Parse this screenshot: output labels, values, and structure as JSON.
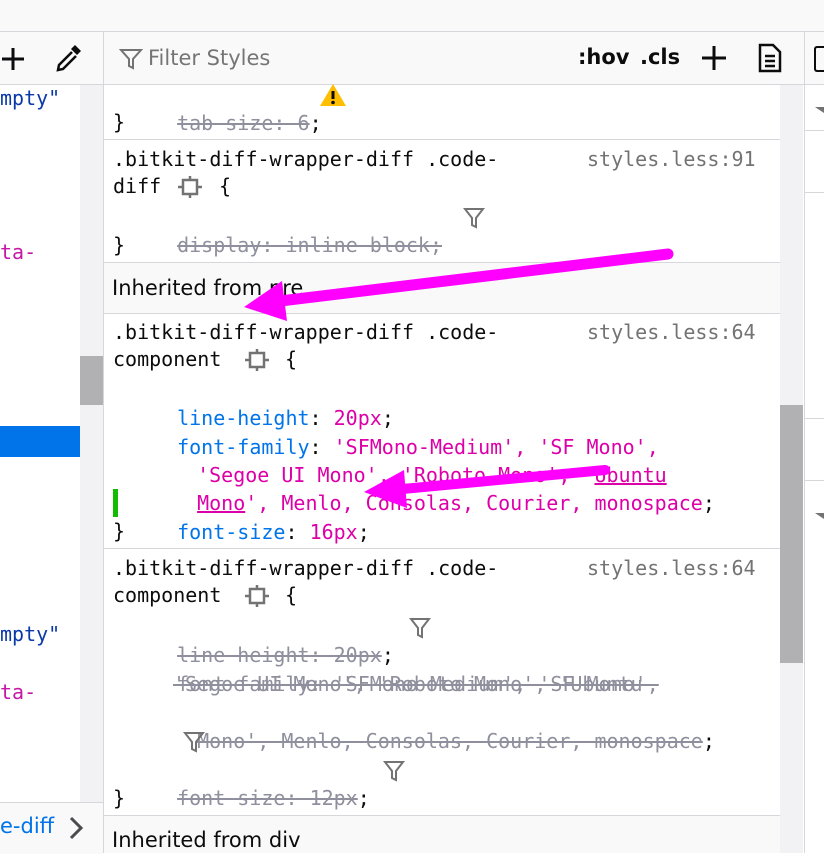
{
  "filter": {
    "placeholder": "Filter Styles"
  },
  "toolbar": {
    "hov": ":hov",
    "cls": ".cls"
  },
  "left_panel": {
    "lines": [
      {
        "text": "mpty\"",
        "kind": "string"
      },
      {
        "text": "ta-",
        "kind": "attr"
      },
      {
        "text": "mpty\"",
        "kind": "string"
      },
      {
        "text": "ta-",
        "kind": "attr"
      }
    ],
    "breadcrumb": "e-diff"
  },
  "rules": {
    "r0": {
      "decl": {
        "prop": "tab-size",
        "value": "6"
      },
      "close": "}"
    },
    "r1": {
      "sel1": ".bitkit-diff-wrapper-diff .code-",
      "sel2": "diff",
      "source": "styles.less:91",
      "decl": {
        "prop": "display",
        "value": "inline-block"
      },
      "close": "}"
    },
    "inherited1": "Inherited from pre",
    "r2": {
      "sel1": ".bitkit-diff-wrapper-diff .code-",
      "sel2": "component",
      "source": "styles.less:64",
      "d1": {
        "prop": "line-height",
        "value": "20px"
      },
      "d2": {
        "prop": "font-family",
        "v1": "'SFMono-Medium', 'SF Mono',",
        "v2a": "'Segoe UI Mono', 'Roboto Mono', '",
        "v2b": "Ubuntu",
        "v3a": "Mono",
        "v3b": "', Menlo, Consolas, Courier, monospace"
      },
      "d3": {
        "prop": "font-size",
        "value": "16px"
      },
      "close": "}"
    },
    "r3": {
      "sel1": ".bitkit-diff-wrapper-diff .code-",
      "sel2": "component",
      "source": "styles.less:64",
      "d1": {
        "prop": "line-height",
        "value": "20px"
      },
      "d2": {
        "prop": "font-family",
        "v1": "'SFMono-Medium', 'SF Mono',",
        "v2": "'Segoe UI Mono', 'Roboto Mono', 'Ubuntu",
        "v3": "Mono', Menlo, Consolas, Courier, monospace"
      },
      "d3": {
        "prop": "font-size",
        "value": "12px"
      },
      "close": "}"
    },
    "inherited2": "Inherited from div"
  },
  "colors": {
    "annotation_arrow": "#ff00ff",
    "selection": "#0074e8",
    "property": "#0074e8",
    "value": "#dd00a9",
    "changed_marker": "#12bc00",
    "warning": "#ffbf00"
  }
}
